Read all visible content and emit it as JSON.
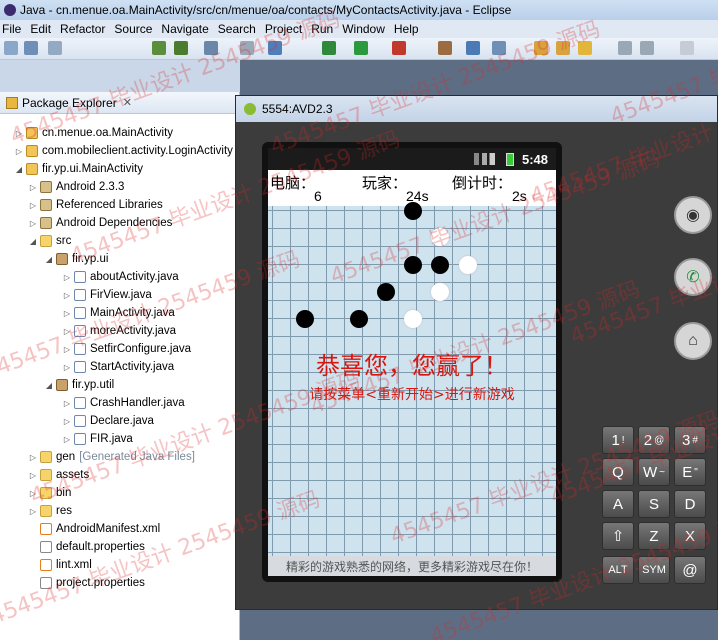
{
  "window": {
    "title": "Java - cn.menue.oa.MainActivity/src/cn/menue/oa/contacts/MyContactsActivity.java - Eclipse"
  },
  "menu": [
    "File",
    "Edit",
    "Refactor",
    "Source",
    "Navigate",
    "Search",
    "Project",
    "Run",
    "Window",
    "Help"
  ],
  "package_explorer": {
    "tab_label": "Package Explorer",
    "tree": [
      {
        "label": "cn.menue.oa.MainActivity",
        "type": "proj"
      },
      {
        "label": "com.mobileclient.activity.LoginActivity",
        "type": "proj"
      },
      {
        "label": "fir.yp.ui.MainActivity",
        "type": "proj"
      },
      {
        "label": "Android 2.3.3",
        "type": "lib"
      },
      {
        "label": "Referenced Libraries",
        "type": "lib"
      },
      {
        "label": "Android Dependencies",
        "type": "lib"
      },
      {
        "label": "src",
        "type": "fold"
      },
      {
        "label": "fir.yp.ui",
        "type": "pkg"
      },
      {
        "label": "aboutActivity.java",
        "type": "java"
      },
      {
        "label": "FirView.java",
        "type": "java"
      },
      {
        "label": "MainActivity.java",
        "type": "java"
      },
      {
        "label": "moreActivity.java",
        "type": "java"
      },
      {
        "label": "SetfirConfigure.java",
        "type": "java"
      },
      {
        "label": "StartActivity.java",
        "type": "java"
      },
      {
        "label": "fir.yp.util",
        "type": "pkg"
      },
      {
        "label": "CrashHandler.java",
        "type": "java"
      },
      {
        "label": "Declare.java",
        "type": "java"
      },
      {
        "label": "FIR.java",
        "type": "java"
      },
      {
        "label": "gen",
        "type": "fold",
        "note": "[Generated Java Files]"
      },
      {
        "label": "assets",
        "type": "fold"
      },
      {
        "label": "bin",
        "type": "fold"
      },
      {
        "label": "res",
        "type": "fold"
      },
      {
        "label": "AndroidManifest.xml",
        "type": "xml"
      },
      {
        "label": "default.properties",
        "type": "file"
      },
      {
        "label": "lint.xml",
        "type": "xml"
      },
      {
        "label": "project.properties",
        "type": "file"
      }
    ]
  },
  "emulator": {
    "title": "5554:AVD2.3",
    "clock": "5:48",
    "hud": {
      "computer_label": "电脑：",
      "computer_value": "6",
      "player_label": "玩家：",
      "player_value": "24s",
      "timer_label": "倒计时：",
      "timer_value": "2s"
    },
    "win_text": "恭喜您，您赢了！",
    "hint_text": "请按菜单<重新开始>进行新游戏",
    "footer": "精彩的游戏熟悉的网络，更多精彩游戏尽在你！",
    "keys": [
      "1",
      "2",
      "3",
      "Q",
      "W",
      "E",
      "A",
      "S",
      "D",
      "⇧",
      "Z",
      "X",
      "ALT",
      "SYM",
      "@"
    ],
    "key_symbols": [
      "!",
      "@",
      "#",
      "",
      "~",
      "\""
    ]
  }
}
